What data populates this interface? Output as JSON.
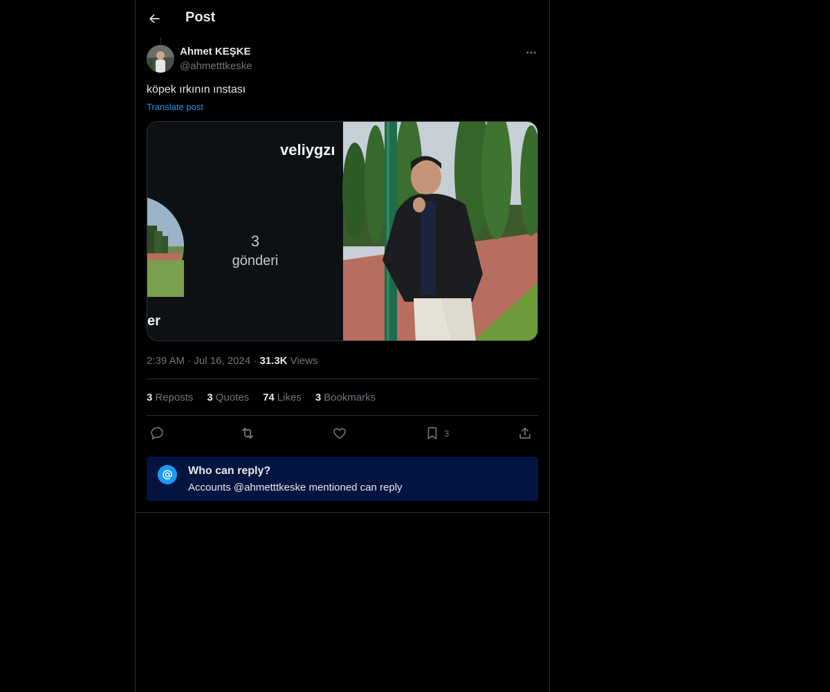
{
  "header": {
    "title": "Post",
    "back_icon": "arrow-left-icon"
  },
  "author": {
    "name": "Ahmet KEŞKE",
    "handle": "@ahmetttkeske"
  },
  "post": {
    "text": "köpek ırkının ınstası",
    "translate_label": "Translate post",
    "media": {
      "left_panel": {
        "username_fragment": "veliygzı",
        "post_count": "3",
        "post_label": "gönderi",
        "bottom_fragment": "er"
      }
    },
    "time": "2:39 AM",
    "date": "Jul 16, 2024",
    "views_count": "31.3K",
    "views_label": "Views"
  },
  "stats": [
    {
      "count": "3",
      "label": "Reposts"
    },
    {
      "count": "3",
      "label": "Quotes"
    },
    {
      "count": "74",
      "label": "Likes"
    },
    {
      "count": "3",
      "label": "Bookmarks"
    }
  ],
  "actions": {
    "reply_icon": "reply-icon",
    "repost_icon": "repost-icon",
    "like_icon": "heart-icon",
    "bookmark_icon": "bookmark-icon",
    "bookmark_count": "3",
    "share_icon": "share-icon"
  },
  "reply_restriction": {
    "title": "Who can reply?",
    "subtitle": "Accounts @ahmetttkeske mentioned can reply"
  },
  "colors": {
    "accent": "#1d9bf0",
    "reply_box_bg": "#031441",
    "border": "#2f3336",
    "muted": "#71767b"
  }
}
